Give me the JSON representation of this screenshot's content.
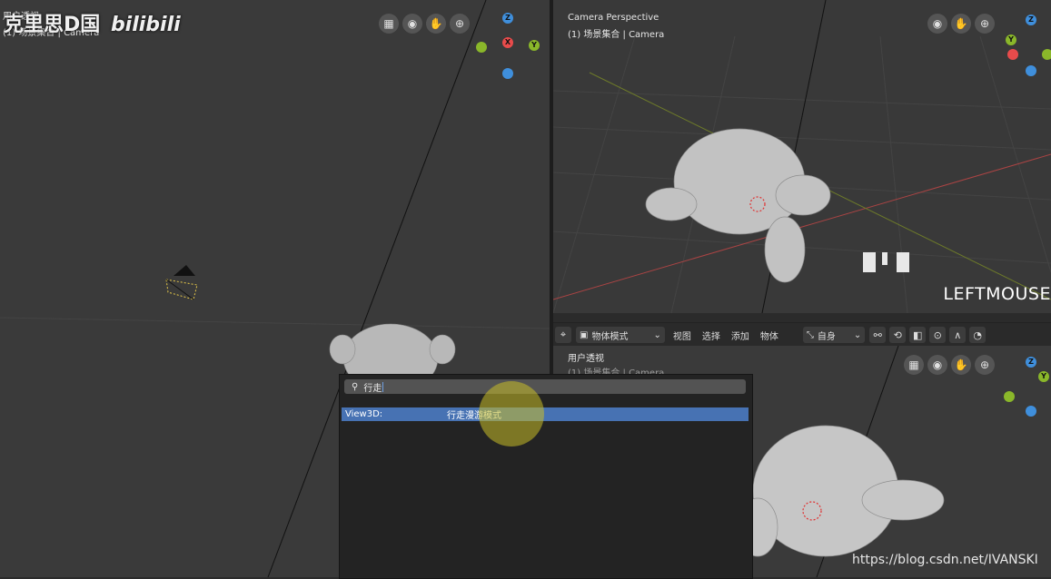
{
  "watermark": {
    "channel": "克里思D国",
    "site": "bilibili",
    "url": "https://blog.csdn.net/IVANSKI"
  },
  "left_viewport": {
    "title": "用户透视",
    "subtitle": "(1) 场景集合 | Camera"
  },
  "top_right_viewport": {
    "title": "Camera Perspective",
    "subtitle": "(1) 场景集合 | Camera",
    "key_overlay": "LEFTMOUSE"
  },
  "bottom_right_viewport": {
    "title": "用户透视",
    "subtitle": "(1) 场景集合 | Camera"
  },
  "header": {
    "mode": "物体模式",
    "menu_view": "视图",
    "menu_select": "选择",
    "menu_add": "添加",
    "menu_object": "物体",
    "pivot": "自身"
  },
  "gizmo": {
    "z": "Z",
    "y": "Y",
    "x": "X"
  },
  "search": {
    "query": "行走",
    "result_category": "View3D:",
    "result_label": "行走漫游模式"
  },
  "colors": {
    "result_highlight": "#4772b3",
    "axis_x": "#e84b4b",
    "axis_y": "#8ab72a",
    "axis_z": "#3f8fdc"
  }
}
